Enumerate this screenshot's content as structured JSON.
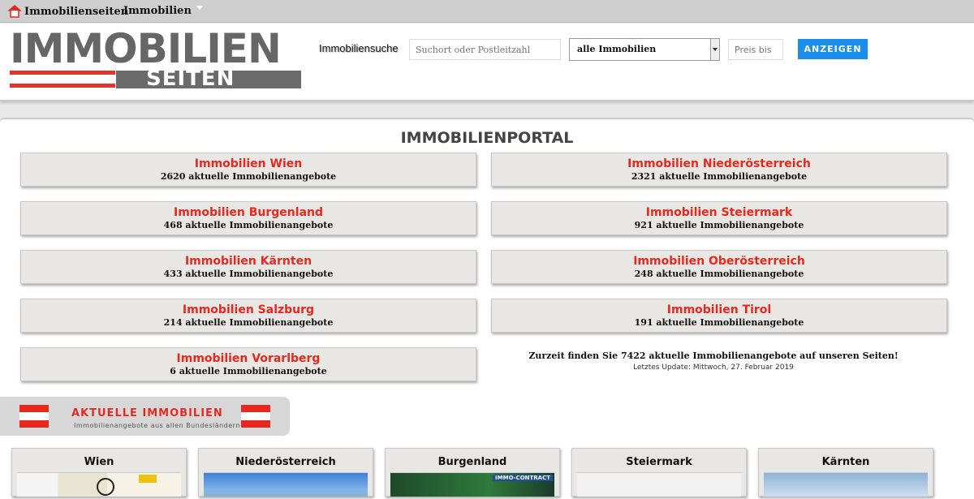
{
  "topbar": {
    "nav_home_label": "Immobilienseiten",
    "nav_immo_label": "Immobilien"
  },
  "logo": {
    "top_text": "IMMOBILIEN",
    "bottom_text": "SEITEN"
  },
  "search": {
    "label": "Immobiliensuche",
    "location_placeholder": "Suchort oder Postleitzahl",
    "type_selected": "alle Immobilien",
    "price_placeholder": "Preis bis",
    "submit_label": "ANZEIGEN"
  },
  "portal": {
    "title": "IMMOBILIENPORTAL",
    "regions": [
      {
        "name": "Immobilien Wien",
        "count": "2620 aktuelle Immobilienangebote"
      },
      {
        "name": "Immobilien Niederösterreich",
        "count": "2321 aktuelle Immobilienangebote"
      },
      {
        "name": "Immobilien Burgenland",
        "count": "468 aktuelle Immobilienangebote"
      },
      {
        "name": "Immobilien Steiermark",
        "count": "921 aktuelle Immobilienangebote"
      },
      {
        "name": "Immobilien Kärnten",
        "count": "433 aktuelle Immobilienangebote"
      },
      {
        "name": "Immobilien Oberösterreich",
        "count": "248 aktuelle Immobilienangebote"
      },
      {
        "name": "Immobilien Salzburg",
        "count": "214 aktuelle Immobilienangebote"
      },
      {
        "name": "Immobilien Tirol",
        "count": "191 aktuelle Immobilienangebote"
      },
      {
        "name": "Immobilien Vorarlberg",
        "count": "6 aktuelle Immobilienangebote"
      }
    ],
    "summary": "Zurzeit finden Sie 7422 aktuelle Immobilienangebote auf unseren Seiten!",
    "last_update": "Letztes Update: Mittwoch, 27. Februar 2019"
  },
  "banner": {
    "title": "AKTUELLE IMMOBILIEN",
    "subtitle": "Immobilienangebote aus allen Bundesländern"
  },
  "cards": [
    {
      "title": "Wien"
    },
    {
      "title": "Niederösterreich"
    },
    {
      "title": "Burgenland",
      "tag": "IMMO-CONTRACT"
    },
    {
      "title": "Steiermark"
    },
    {
      "title": "Kärnten"
    }
  ],
  "colors": {
    "accent_red": "#e8271f",
    "button_blue": "#1a8ee8",
    "logo_grey": "#666666"
  },
  "icons": [
    "house-icon",
    "chevron-down-icon",
    "austria-flag-icon"
  ]
}
